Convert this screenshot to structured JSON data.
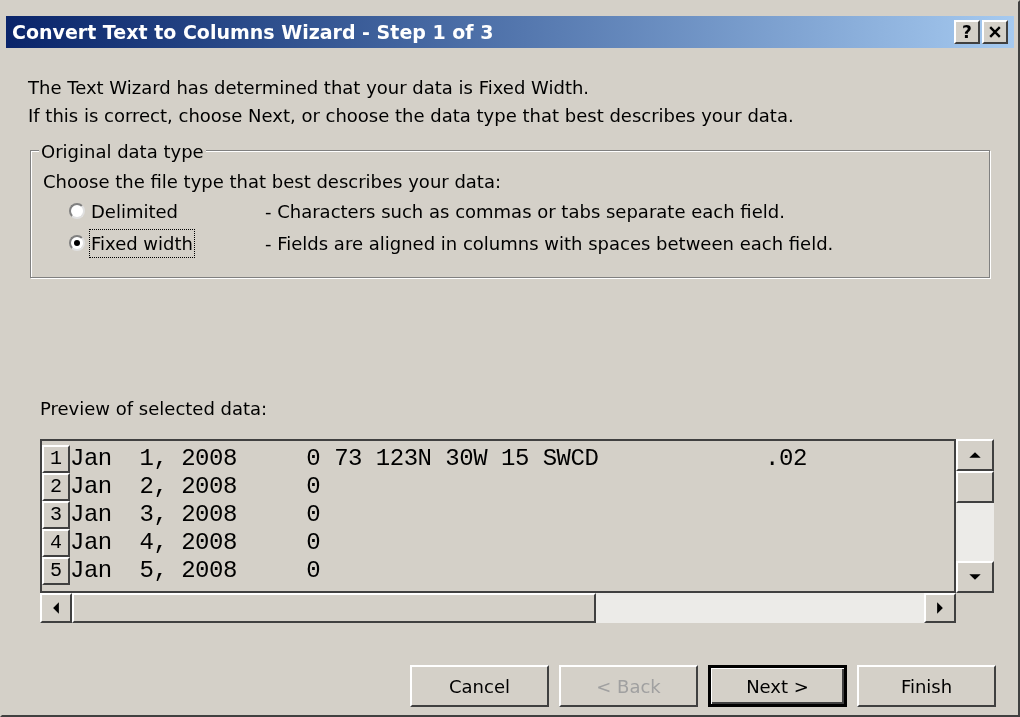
{
  "window": {
    "title": "Convert Text to Columns Wizard - Step 1 of 3",
    "help_button": "?"
  },
  "intro": [
    "The Text Wizard has determined that your data is Fixed Width.",
    "If this is correct, choose Next, or choose the data type that best describes your data."
  ],
  "group": {
    "title": "Original data type",
    "prompt": "Choose the file type that best describes your data:",
    "options": [
      {
        "label": "Delimited",
        "description": "- Characters such as commas or tabs separate each field.",
        "selected": false
      },
      {
        "label": "Fixed width",
        "description": "- Fields are aligned in columns with spaces between each field.",
        "selected": true
      }
    ]
  },
  "preview": {
    "label": "Preview of selected data:",
    "rows": [
      {
        "number": "1",
        "text": "Jan  1, 2008     0 73 123N 30W 15 SWCD            .02"
      },
      {
        "number": "2",
        "text": "Jan  2, 2008     0"
      },
      {
        "number": "3",
        "text": "Jan  3, 2008     0"
      },
      {
        "number": "4",
        "text": "Jan  4, 2008     0"
      },
      {
        "number": "5",
        "text": "Jan  5, 2008     0"
      }
    ]
  },
  "buttons": [
    {
      "label": "Cancel",
      "disabled": false,
      "default": false
    },
    {
      "label": "< Back",
      "disabled": true,
      "default": false
    },
    {
      "label": "Next >",
      "disabled": false,
      "default": true
    },
    {
      "label": "Finish",
      "disabled": false,
      "default": false
    }
  ]
}
